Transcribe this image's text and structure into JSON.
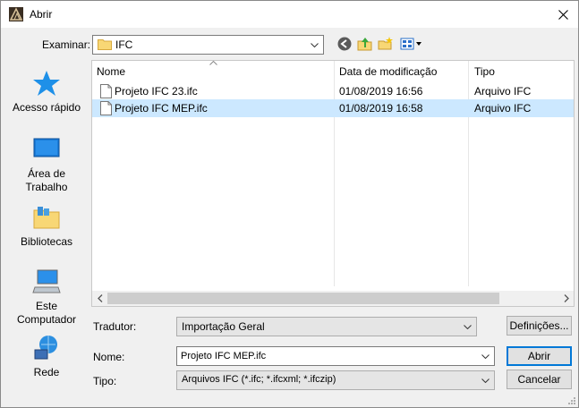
{
  "window": {
    "title": "Abrir"
  },
  "lookin": {
    "label": "Examinar:",
    "value": "IFC"
  },
  "places": [
    {
      "label": "Acesso rápido",
      "icon": "quick-access-star-icon"
    },
    {
      "label": "Área de Trabalho",
      "icon": "desktop-icon"
    },
    {
      "label": "Bibliotecas",
      "icon": "libraries-icon"
    },
    {
      "label": "Este Computador",
      "icon": "this-pc-icon"
    },
    {
      "label": "Rede",
      "icon": "network-icon"
    }
  ],
  "columns": {
    "name": "Nome",
    "date": "Data de modificação",
    "type": "Tipo"
  },
  "files": [
    {
      "name": "Projeto IFC 23.ifc",
      "date": "01/08/2019 16:56",
      "type": "Arquivo IFC",
      "selected": false
    },
    {
      "name": "Projeto IFC MEP.ifc",
      "date": "01/08/2019 16:58",
      "type": "Arquivo IFC",
      "selected": true
    }
  ],
  "translator": {
    "label": "Tradutor:",
    "value": "Importação Geral",
    "settings_button": "Definições..."
  },
  "filename": {
    "label": "Nome:",
    "value": "Projeto IFC MEP.ifc"
  },
  "filetype": {
    "label": "Tipo:",
    "value": "Arquivos IFC (*.ifc; *.ifcxml; *.ifczip)"
  },
  "buttons": {
    "open": "Abrir",
    "cancel": "Cancelar"
  },
  "colors": {
    "selection": "#cce8ff",
    "accent": "#0078d7",
    "folder": "#f8d775"
  }
}
